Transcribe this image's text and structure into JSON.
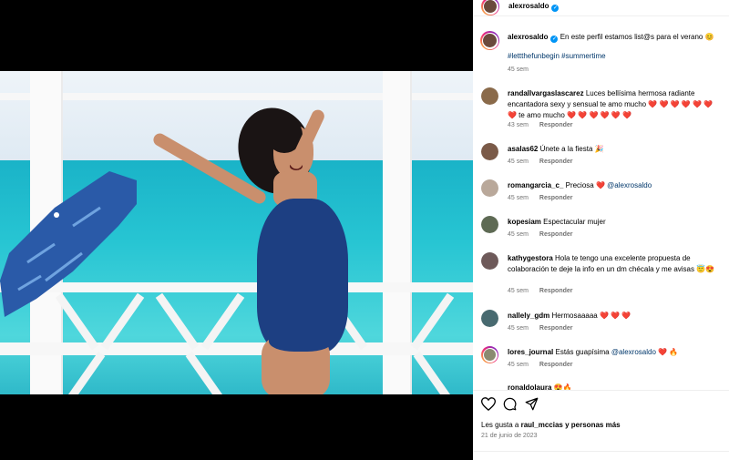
{
  "post": {
    "author": "alexrosaldo",
    "caption": "En este perfil estamos list@s para el verano 😊",
    "hashtags": "#lettthefunbegin #summertime",
    "caption_time": "45 sem"
  },
  "comments": [
    {
      "user": "randallvargaslascarez",
      "text": "Luces bellísima hermosa radiante encantadora sexy y sensual te amo mucho ❤️ ❤️ ❤️ ❤️ ❤️ ❤️ ❤️ te amo mucho ❤️ ❤️ ❤️ ❤️ ❤️ ❤️",
      "time": "43 sem",
      "reply": "Responder"
    },
    {
      "user": "asalas62",
      "text": "Únete a la fiesta 🎉",
      "time": "45 sem",
      "reply": "Responder"
    },
    {
      "user": "romangarcia_c_",
      "text": "Preciosa ❤️",
      "mention": "@alexrosaldo",
      "time": "45 sem",
      "reply": "Responder"
    },
    {
      "user": "kopesiam",
      "text": "Espectacular mujer",
      "time": "45 sem",
      "reply": "Responder"
    },
    {
      "user": "kathygestora",
      "text": "Hola te tengo una excelente propuesta de colaboración te deje la info en un dm chécala y me avisas 😇😍",
      "time": "45 sem",
      "reply": "Responder"
    },
    {
      "user": "nallely_gdm",
      "text": "Hermosaaaaa ❤️ ❤️ ❤️",
      "time": "45 sem",
      "reply": "Responder"
    },
    {
      "user": "lores_journal",
      "text": "Estás guapísima",
      "mention": "@alexrosaldo",
      "suffix": "❤️ 🔥",
      "time": "45 sem",
      "reply": "Responder"
    },
    {
      "user": "ronaldolaura",
      "text": "😍🔥",
      "time": "",
      "reply": ""
    }
  ],
  "likes": {
    "prefix": "Les gusta a",
    "user": "raul_mccias",
    "suffix": "y personas más"
  },
  "date": "21 de junio de 2023",
  "icons": {
    "like": "heart-icon",
    "comment": "comment-icon",
    "share": "share-icon",
    "verified": "verified-badge-icon"
  },
  "colors": {
    "verified": "#0095f6",
    "link": "#00376b",
    "muted": "#737373",
    "heart": "#ed2e3f"
  }
}
